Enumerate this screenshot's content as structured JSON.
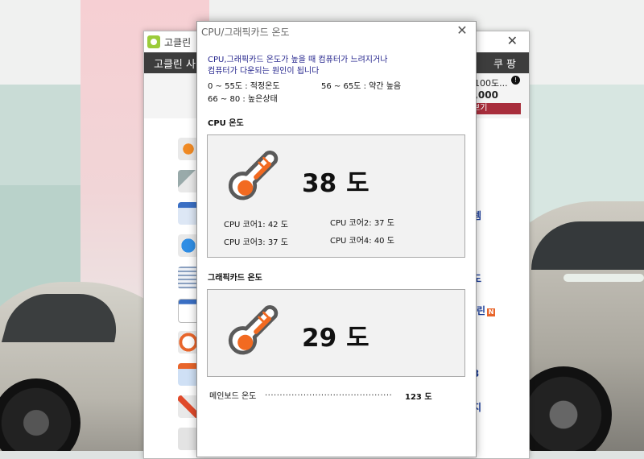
{
  "dialog": {
    "title": "CPU/그래픽카드 온도",
    "notice_line1": "CPU,그래픽카드 온도가 높을 때 컴퓨터가 느려지거나",
    "notice_line2": "컴퓨터가 다운되는 원인이 됩니다",
    "range_normal": "0 ~ 55도 : 적정온도",
    "range_warm": "56 ~ 65도 : 약간 높음",
    "range_high": "66 ~ 80 : 높은상태",
    "cpu": {
      "section_label": "CPU 온도",
      "temp_value": "38",
      "temp_unit": "도",
      "cores": [
        "CPU 코어1: 42 도",
        "CPU 코어2: 37 도",
        "CPU 코어3: 37 도",
        "CPU 코어4: 40 도"
      ]
    },
    "gpu": {
      "section_label": "그래픽카드 온도",
      "temp_value": "29",
      "temp_unit": "도"
    },
    "mainboard": {
      "label": "메인보드 온도",
      "dots": "...........................................",
      "value": "123 도"
    }
  },
  "background_app": {
    "title": "고클린",
    "menu_left": "고클린 사",
    "menu_right": "쿠 팡",
    "promo_line1": "ℓ 100도...",
    "promo_badge": "!",
    "promo_line2": "9,000",
    "promo_button": "보기",
    "side_links": [
      "l",
      "템",
      "도",
      "클린",
      "3",
      "지"
    ],
    "side_new_badge": "N"
  },
  "colors": {
    "thermo_orange": "#f26a21",
    "thermo_outline": "#5a5a5a",
    "notice_blue": "#23238c",
    "app_bar": "#3d3d3d"
  },
  "icons": [
    "close-icon",
    "thermometer-icon",
    "app-logo-icon"
  ]
}
